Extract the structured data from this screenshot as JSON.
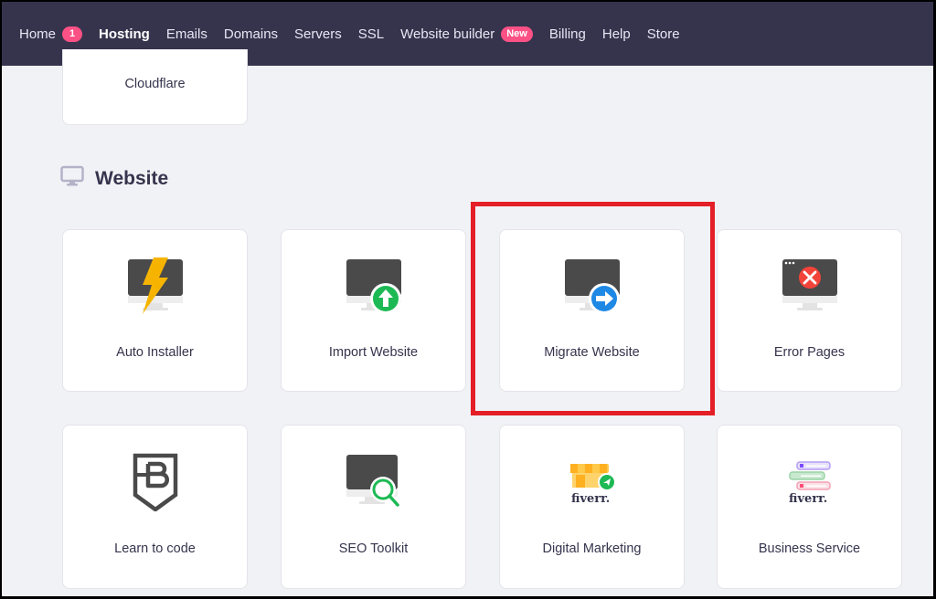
{
  "navbar": {
    "items": [
      {
        "label": "Home",
        "badge": "1"
      },
      {
        "label": "Hosting"
      },
      {
        "label": "Emails"
      },
      {
        "label": "Domains"
      },
      {
        "label": "Servers"
      },
      {
        "label": "SSL"
      },
      {
        "label": "Website builder",
        "badge": "New"
      },
      {
        "label": "Billing"
      },
      {
        "label": "Help"
      },
      {
        "label": "Store"
      }
    ]
  },
  "previous_section": {
    "cards": [
      {
        "label": "Cloudflare"
      }
    ]
  },
  "website_section": {
    "title": "Website",
    "icon": "monitor-icon",
    "cards": [
      {
        "label": "Auto Installer",
        "icon": "auto-installer-icon"
      },
      {
        "label": "Import Website",
        "icon": "import-website-icon"
      },
      {
        "label": "Migrate Website",
        "icon": "migrate-website-icon",
        "highlighted": true
      },
      {
        "label": "Error Pages",
        "icon": "error-pages-icon"
      },
      {
        "label": "Learn to code",
        "icon": "learn-to-code-icon"
      },
      {
        "label": "SEO Toolkit",
        "icon": "seo-toolkit-icon"
      },
      {
        "label": "Digital Marketing",
        "icon": "fiverr-digital-marketing-icon",
        "brand": "fiverr."
      },
      {
        "label": "Business Service",
        "icon": "fiverr-business-service-icon",
        "brand": "fiverr."
      }
    ]
  },
  "colors": {
    "navbar_bg": "#36344d",
    "badge": "#fc5185",
    "page_bg": "#f1f2f6",
    "highlight": "#e41f27",
    "success_green": "#1db954",
    "info_blue": "#1e88e5",
    "error_red": "#f2433a",
    "warning_yellow": "#f6b400"
  }
}
